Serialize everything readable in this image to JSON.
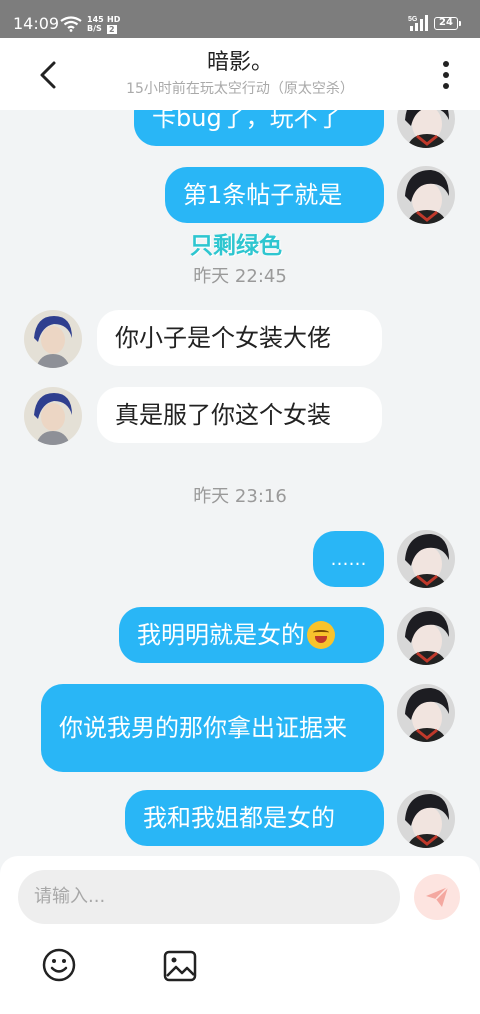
{
  "status_bar": {
    "time": "14:09",
    "net_speed_top": "145",
    "net_speed_bottom": "B/S",
    "hd_label": "HD",
    "hd_sub": "2",
    "signal_label": "5G",
    "battery": "24"
  },
  "header": {
    "title": "暗影。",
    "subtitle": "15小时前在玩太空行动（原太空杀）"
  },
  "chat": {
    "msg1": "卡bug了，玩不了",
    "msg2": "第1条帖子就是",
    "sticker_text": "只剩绿色",
    "time1": "昨天 22:45",
    "msg3": "你小子是个女装大佬",
    "msg4": "真是服了你这个女装",
    "time2": "昨天 23:16",
    "msg5": "……",
    "msg6": "我明明就是女的",
    "msg7": "你说我男的那你拿出证据来",
    "msg8": "我和我姐都是女的"
  },
  "composer": {
    "placeholder": "请输入..."
  },
  "colors": {
    "outgoing_bubble": "#29b6f6",
    "incoming_bubble": "#ffffff",
    "background": "#f2f4f5",
    "send_button": "#fde4e0",
    "send_icon": "#f4a8a0"
  },
  "icons": {
    "back": "back-arrow-icon",
    "more": "more-vertical-icon",
    "send": "paper-plane-icon",
    "emoji": "smiley-icon",
    "image": "image-icon"
  }
}
